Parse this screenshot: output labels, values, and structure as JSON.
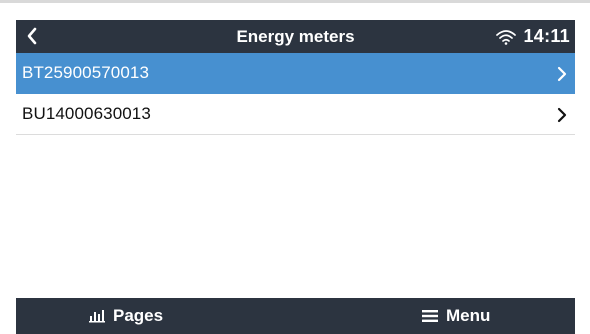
{
  "header": {
    "title": "Energy meters",
    "time": "14:11",
    "back_icon": "chevron-left-icon",
    "wifi_icon": "wifi-icon"
  },
  "list": {
    "items": [
      {
        "label": "BT25900570013",
        "selected": true,
        "icon": "chevron-right-icon"
      },
      {
        "label": "BU14000630013",
        "selected": false,
        "icon": "chevron-right-icon"
      }
    ]
  },
  "footer": {
    "pages_label": "Pages",
    "menu_label": "Menu",
    "pages_icon": "bar-chart-icon",
    "menu_icon": "hamburger-menu-icon"
  },
  "colors": {
    "bar_background": "#2c3440",
    "selected_row": "#4790d0",
    "text_on_dark": "#ffffff",
    "text_on_light": "#111111"
  }
}
